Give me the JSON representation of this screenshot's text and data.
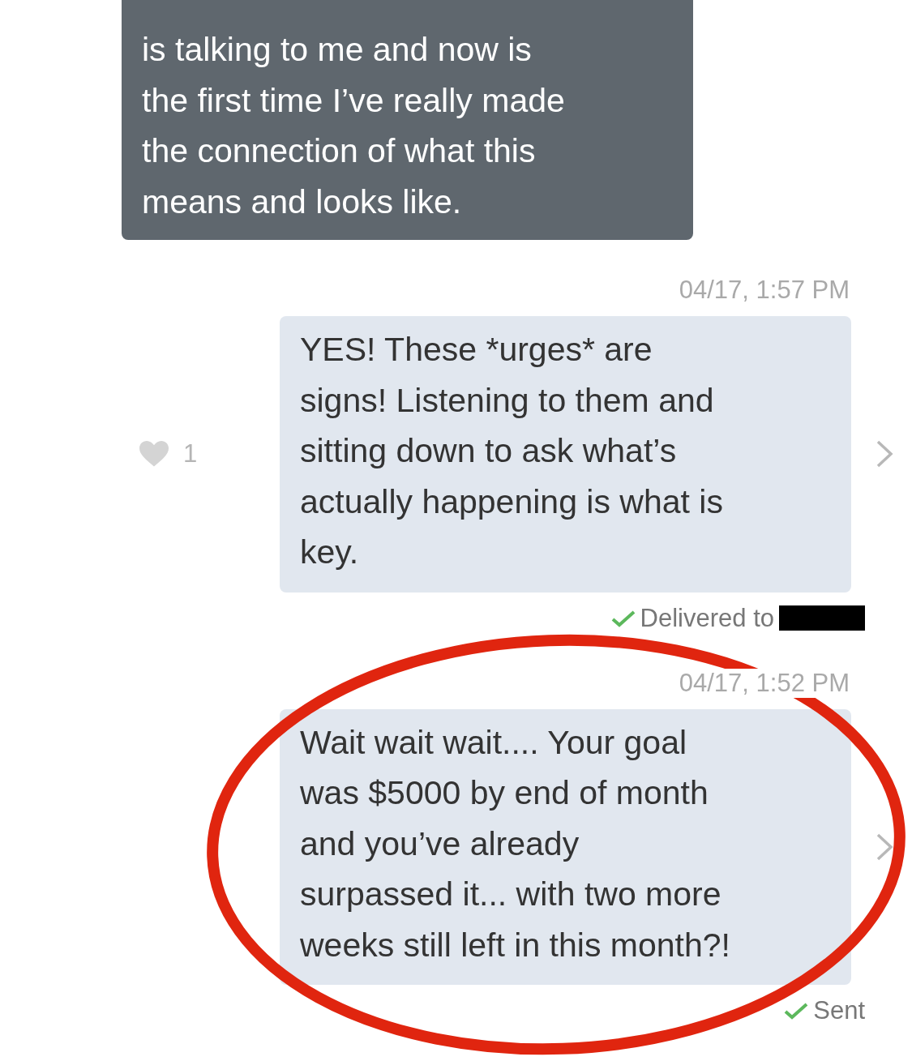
{
  "messages": [
    {
      "kind": "incoming",
      "text": "is talking to me and now is\nthe first time I’ve really made\nthe connection of what this\nmeans and looks like."
    },
    {
      "kind": "outgoing",
      "timestamp": "04/17, 1:57 PM",
      "text": "YES! These *urges* are\nsigns! Listening to them and\nsitting down to ask what’s\nactually happening is what is\nkey.",
      "likes": "1",
      "status": {
        "text": "Delivered to",
        "redacted": true
      }
    },
    {
      "kind": "outgoing",
      "timestamp": "04/17, 1:52 PM",
      "text": "Wait wait wait.... Your goal\nwas $5000 by end of month\nand you’ve already\nsurpassed it... with two more\nweeks still left in this month?!",
      "status": {
        "text": "Sent"
      }
    }
  ],
  "annotation": {
    "kind": "ellipse"
  }
}
